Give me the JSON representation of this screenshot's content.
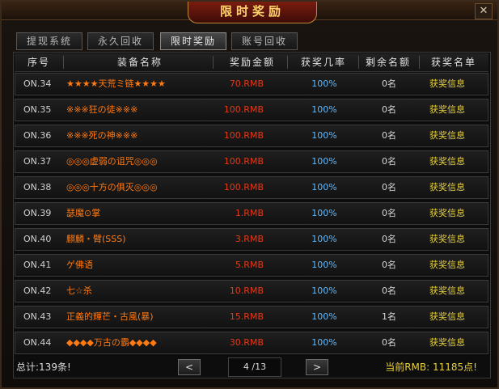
{
  "window": {
    "title": "限时奖励",
    "close_label": "✕"
  },
  "tabs": [
    {
      "label": "提现系统",
      "active": false
    },
    {
      "label": "永久回收",
      "active": false
    },
    {
      "label": "限时奖励",
      "active": true
    },
    {
      "label": "账号回收",
      "active": false
    }
  ],
  "columns": [
    "序号",
    "装备名称",
    "奖励金额",
    "获奖几率",
    "剩余名额",
    "获奖名单"
  ],
  "rows": [
    {
      "no": "ON.34",
      "name": "★★★★天荒ミ链★★★★",
      "amount": "70.RMB",
      "rate": "100%",
      "left": "0名",
      "info": "获奖信息"
    },
    {
      "no": "ON.35",
      "name": "※※※狂の徒※※※",
      "amount": "100.RMB",
      "rate": "100%",
      "left": "0名",
      "info": "获奖信息"
    },
    {
      "no": "ON.36",
      "name": "※※※死の神※※※",
      "amount": "100.RMB",
      "rate": "100%",
      "left": "0名",
      "info": "获奖信息"
    },
    {
      "no": "ON.37",
      "name": "◎◎◎虚弱の诅咒◎◎◎",
      "amount": "100.RMB",
      "rate": "100%",
      "left": "0名",
      "info": "获奖信息"
    },
    {
      "no": "ON.38",
      "name": "◎◎◎十方の俱灭◎◎◎",
      "amount": "100.RMB",
      "rate": "100%",
      "left": "0名",
      "info": "获奖信息"
    },
    {
      "no": "ON.39",
      "name": "瑟魔⊙掌",
      "amount": "1.RMB",
      "rate": "100%",
      "left": "0名",
      "info": "获奖信息"
    },
    {
      "no": "ON.40",
      "name": "麒麟・臂(SSS)",
      "amount": "3.RMB",
      "rate": "100%",
      "left": "0名",
      "info": "获奖信息"
    },
    {
      "no": "ON.41",
      "name": "ゲ佛语",
      "amount": "5.RMB",
      "rate": "100%",
      "left": "0名",
      "info": "获奖信息"
    },
    {
      "no": "ON.42",
      "name": "七☆杀",
      "amount": "10.RMB",
      "rate": "100%",
      "left": "0名",
      "info": "获奖信息"
    },
    {
      "no": "ON.43",
      "name": "正義的輝芒・古風(暴)",
      "amount": "15.RMB",
      "rate": "100%",
      "left": "1名",
      "info": "获奖信息"
    },
    {
      "no": "ON.44",
      "name": "◆◆◆◆万古の霸◆◆◆◆",
      "amount": "30.RMB",
      "rate": "100%",
      "left": "0名",
      "info": "获奖信息"
    }
  ],
  "footer": {
    "total": "总计:139条!",
    "prev_label": "<",
    "page": "4 /13",
    "next_label": ">",
    "balance": "当前RMB: 11185点!"
  },
  "colors": {
    "name": "#ff7a12",
    "amount": "#e03a1a",
    "rate": "#5cb8ff",
    "info": "#e8d038"
  }
}
